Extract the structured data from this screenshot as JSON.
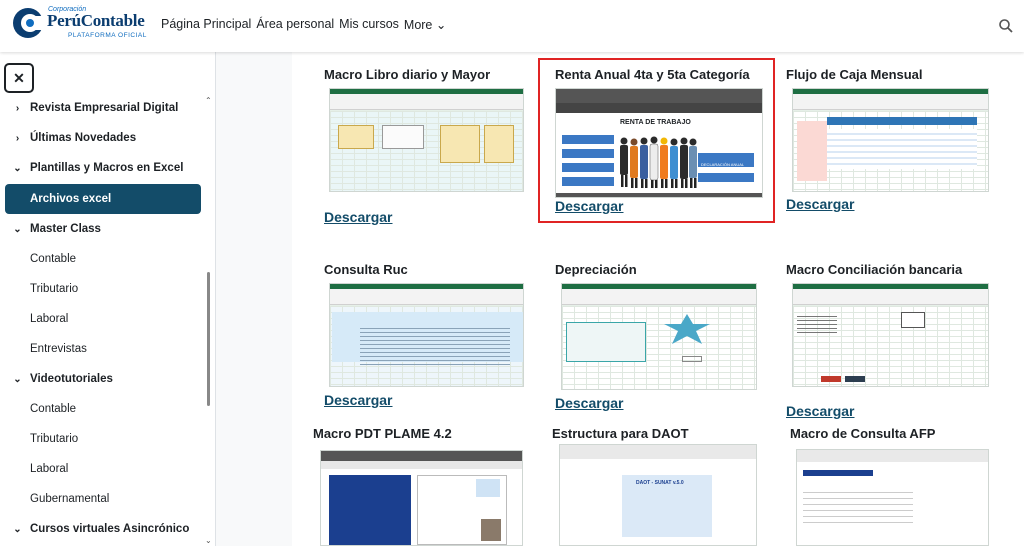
{
  "brand": {
    "small": "Corporación",
    "name": "PerúContable",
    "tagline": "PLATAFORMA OFICIAL"
  },
  "nav": {
    "items": [
      "Página Principal",
      "Área personal",
      "Mis cursos",
      "More ⌄"
    ]
  },
  "sidebar": {
    "close_label": "✕",
    "items": [
      {
        "label": "Revista Empresarial Digital",
        "chev": "›"
      },
      {
        "label": "Últimas Novedades",
        "chev": "›"
      },
      {
        "label": "Plantillas y Macros en Excel",
        "chev": "⌄"
      },
      {
        "label": "Archivos excel",
        "chev": ""
      },
      {
        "label": "Master Class",
        "chev": "⌄"
      },
      {
        "label": "Contable",
        "chev": ""
      },
      {
        "label": "Tributario",
        "chev": ""
      },
      {
        "label": "Laboral",
        "chev": ""
      },
      {
        "label": "Entrevistas",
        "chev": ""
      },
      {
        "label": "Videotutoriales",
        "chev": "⌄"
      },
      {
        "label": "Contable",
        "chev": ""
      },
      {
        "label": "Tributario",
        "chev": ""
      },
      {
        "label": "Laboral",
        "chev": ""
      },
      {
        "label": "Gubernamental",
        "chev": ""
      },
      {
        "label": "Cursos virtuales Asincrónico",
        "chev": "⌄"
      }
    ]
  },
  "cards": [
    {
      "title": "Macro Libro diario y Mayor",
      "link": "Descargar"
    },
    {
      "title": "Renta Anual 4ta y 5ta Categoría",
      "link": "Descargar",
      "thumb_heading": "RENTA DE TRABAJO",
      "thumb_buttons": [
        "NORMATIVA",
        "IMPORTAR DB",
        "RENTA DE 4TA",
        "RENTA DE 5TA",
        "DECLARACIÓN ANUAL",
        "RESUMEN"
      ]
    },
    {
      "title": "Flujo de Caja Mensual",
      "link": "Descargar"
    },
    {
      "title": "Consulta Ruc",
      "link": "Descargar"
    },
    {
      "title": "Depreciación",
      "link": "Descargar"
    },
    {
      "title": "Macro Conciliación bancaria",
      "link": "Descargar"
    },
    {
      "title": "Macro PDT PLAME 4.2"
    },
    {
      "title": "Estructura para DAOT",
      "thumb_heading": "DAOT - SUNAT v.5.0"
    },
    {
      "title": "Macro de Consulta AFP"
    }
  ],
  "colors": {
    "brand": "#0b3d70",
    "active_bg": "#134c69",
    "link": "#134c69",
    "highlight": "#e02424"
  }
}
